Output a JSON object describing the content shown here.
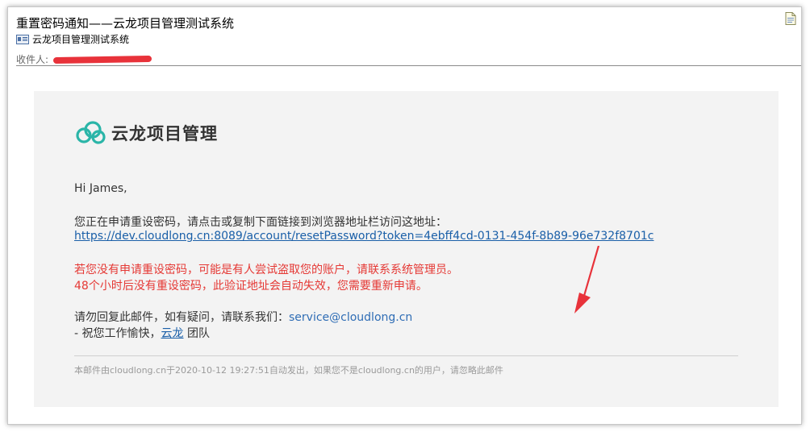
{
  "header": {
    "subject": "重置密码通知——云龙项目管理测试系统",
    "sender_name": "云龙项目管理测试系统",
    "recipients_label": "收件人:"
  },
  "email": {
    "brand_name": "云龙项目管理",
    "greeting": "Hi James,",
    "intro": "您正在申请重设密码，请点击或复制下面链接到浏览器地址栏访问这地址：",
    "reset_link": "https://dev.cloudlong.cn:8089/account/resetPassword?token=4ebff4cd-0131-454f-8b89-96e732f8701c",
    "warning_line1": "若您没有申请重设密码，可能是有人尝试盗取您的账户，请联系系统管理员。",
    "warning_line2": "48个小时后没有重设密码，此验证地址会自动失效，您需要重新申请。",
    "contact_prefix": "请勿回复此邮件，如有疑问，请联系我们：",
    "contact_email": "service@cloudlong.cn",
    "signoff_prefix": "- 祝您工作愉快，",
    "signoff_link": "云龙",
    "signoff_suffix": " 团队",
    "footer": "本邮件由cloudlong.cn于2020-10-12 19:27:51自动发出，如果您不是cloudlong.cn的用户，请忽略此邮件"
  },
  "colors": {
    "brand_teal": "#2bb5a8",
    "link_blue": "#1a5fa8",
    "warning_red": "#e53935",
    "annotation_arrow": "#e8323a",
    "card_background": "#f3f3f3"
  },
  "icons": {
    "sender": "contact-card-icon",
    "document": "document-icon",
    "brand": "cloud-logo-icon"
  }
}
